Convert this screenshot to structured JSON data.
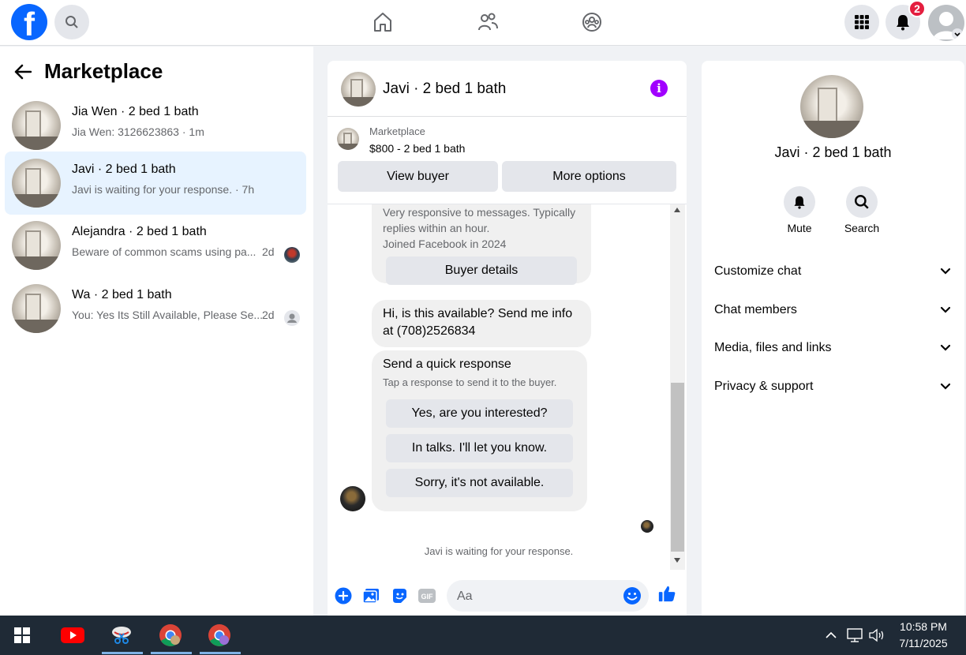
{
  "nav": {
    "notification_count": "2",
    "colors": {
      "brand": "#0866ff",
      "badge": "#e41e3f"
    }
  },
  "left": {
    "title": "Marketplace",
    "conversations": [
      {
        "name": "Jia Wen · 2 bed 1 bath",
        "preview": "Jia Wen: 3126623863 · 1m",
        "time": ""
      },
      {
        "name": "Javi · 2 bed 1 bath",
        "preview": "Javi is waiting for your response. · 7h",
        "time": ""
      },
      {
        "name": "Alejandra · 2 bed 1 bath",
        "preview": "Beware of common scams using pa...",
        "time": "2d"
      },
      {
        "name": "Wa · 2 bed 1 bath",
        "preview": "You: Yes Its Still Available, Please Se...",
        "time": "2d"
      }
    ]
  },
  "chat": {
    "title": "Javi · 2 bed 1 bath",
    "marketplace_label": "Marketplace",
    "listing": "$800 - 2 bed 1 bath",
    "view_buyer": "View buyer",
    "more_options": "More options",
    "buyer_info_line1": "Very responsive to messages. Typically",
    "buyer_info_line2": "replies within an hour.",
    "buyer_info_line3": "Joined Facebook in 2024",
    "buyer_details": "Buyer details",
    "message_line1": "Hi, is this available? Send me info",
    "message_line2": "at (708)2526834",
    "quick_title": "Send a quick response",
    "quick_sub": "Tap a response to send it to the buyer.",
    "quick_options": [
      "Yes, are you interested?",
      "In talks. I'll let you know.",
      "Sorry, it's not available."
    ],
    "waiting": "Javi is waiting for your response.",
    "composer_placeholder": "Aa"
  },
  "right": {
    "name": "Javi · 2 bed 1 bath",
    "actions": [
      "Mute",
      "Search"
    ],
    "sections": [
      "Customize chat",
      "Chat members",
      "Media, files and links",
      "Privacy & support"
    ]
  },
  "taskbar": {
    "time": "10:58 PM",
    "date": "7/11/2025"
  }
}
